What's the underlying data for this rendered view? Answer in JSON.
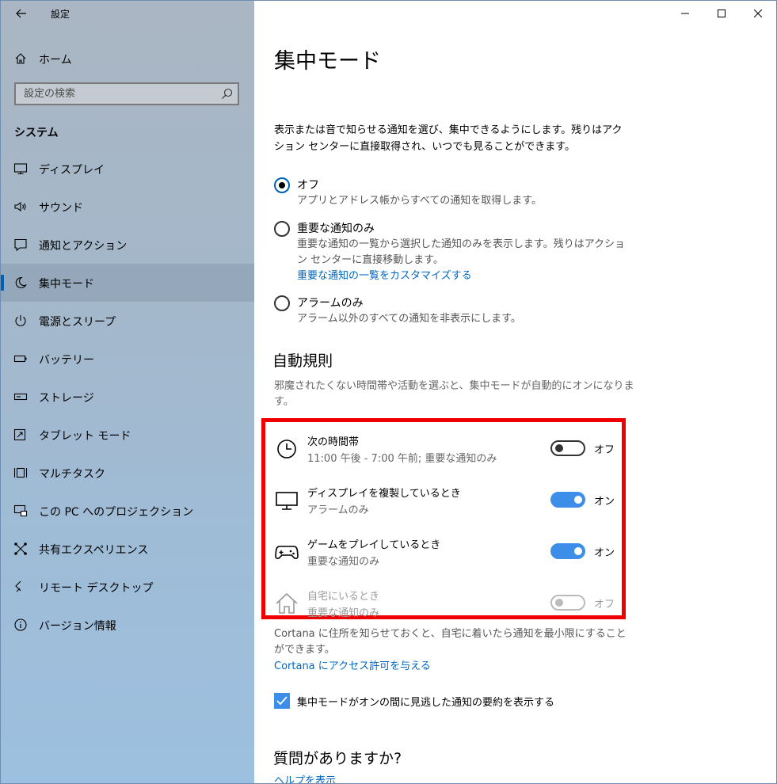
{
  "app": {
    "title": "設定"
  },
  "sidebar": {
    "home_label": "ホーム",
    "search_placeholder": "設定の検索",
    "section_title": "システム",
    "items": [
      {
        "label": "ディスプレイ",
        "icon": "monitor-icon"
      },
      {
        "label": "サウンド",
        "icon": "speaker-icon"
      },
      {
        "label": "通知とアクション",
        "icon": "notification-icon"
      },
      {
        "label": "集中モード",
        "icon": "moon-icon",
        "active": true
      },
      {
        "label": "電源とスリープ",
        "icon": "power-icon"
      },
      {
        "label": "バッテリー",
        "icon": "battery-icon"
      },
      {
        "label": "ストレージ",
        "icon": "storage-icon"
      },
      {
        "label": "タブレット モード",
        "icon": "tablet-icon"
      },
      {
        "label": "マルチタスク",
        "icon": "multitask-icon"
      },
      {
        "label": "この PC へのプロジェクション",
        "icon": "projection-icon"
      },
      {
        "label": "共有エクスペリエンス",
        "icon": "share-icon"
      },
      {
        "label": "リモート デスクトップ",
        "icon": "remote-icon"
      },
      {
        "label": "バージョン情報",
        "icon": "info-icon"
      }
    ]
  },
  "main": {
    "title": "集中モード",
    "description": "表示または音で知らせる通知を選び、集中できるようにします。残りはアクション センターに直接取得され、いつでも見ることができます。",
    "options": [
      {
        "label": "オフ",
        "desc": "アプリとアドレス帳からすべての通知を取得します。",
        "checked": true
      },
      {
        "label": "重要な通知のみ",
        "desc": "重要な通知の一覧から選択した通知のみを表示します。残りはアクション センターに直接移動します。",
        "link": "重要な通知の一覧をカスタマイズする"
      },
      {
        "label": "アラームのみ",
        "desc": "アラーム以外のすべての通知を非表示にします。"
      }
    ],
    "auto_rules": {
      "title": "自動規則",
      "description": "邪魔されたくない時間帯や活動を選ぶと、集中モードが自動的にオンになります。",
      "rules": [
        {
          "title": "次の時間帯",
          "sub": "11:00 午後 - 7:00 午前; 重要な通知のみ",
          "state": "オフ",
          "on": false,
          "icon": "clock-icon"
        },
        {
          "title": "ディスプレイを複製しているとき",
          "sub": "アラームのみ",
          "state": "オン",
          "on": true,
          "icon": "monitor-icon"
        },
        {
          "title": "ゲームをプレイしているとき",
          "sub": "重要な通知のみ",
          "state": "オン",
          "on": true,
          "icon": "gamepad-icon"
        },
        {
          "title": "自宅にいるとき",
          "sub": "重要な通知のみ",
          "state": "オフ",
          "on": false,
          "disabled": true,
          "icon": "home-icon"
        }
      ]
    },
    "cortana_text": "Cortana に住所を知らせておくと、自宅に着いたら通知を最小限にすることができます。",
    "cortana_link": "Cortana にアクセス許可を与える",
    "summary_checkbox": {
      "label": "集中モードがオンの間に見逃した通知の要約を表示する",
      "checked": true
    },
    "faq_title": "質問がありますか?",
    "help_link": "ヘルプを表示"
  },
  "colors": {
    "accent": "#0067c0",
    "toggle_on": "#3d8ee8",
    "highlight": "#ee0000"
  }
}
